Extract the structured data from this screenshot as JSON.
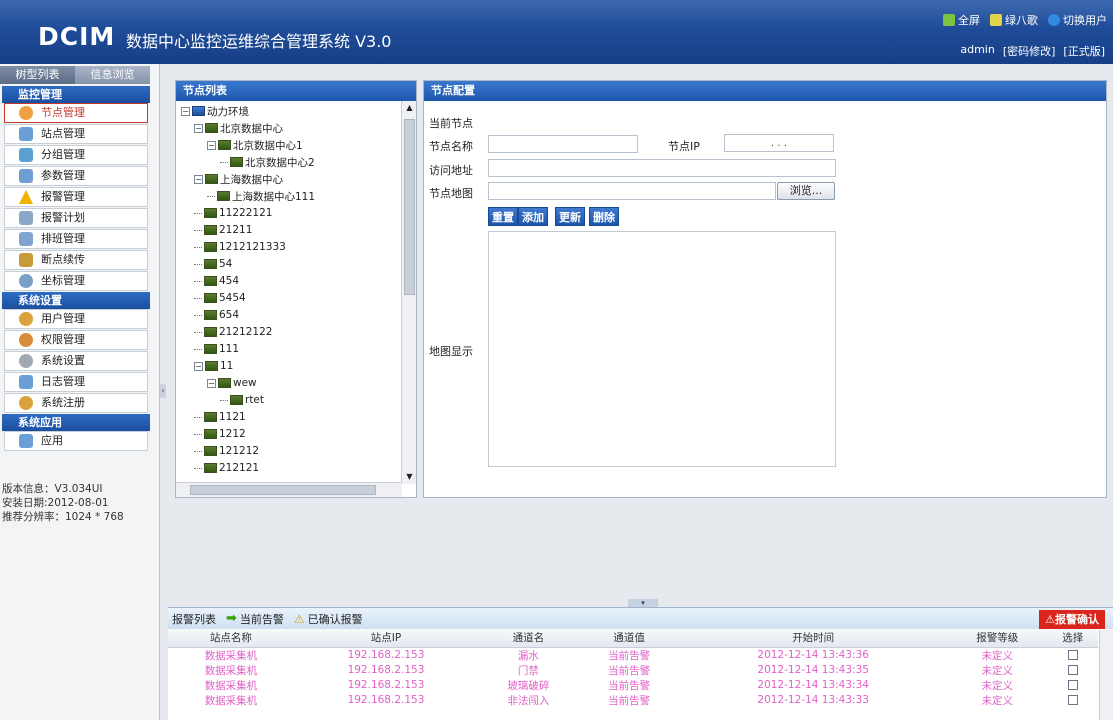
{
  "header": {
    "logo": "DCIM",
    "title": "数据中心监控运维综合管理系统 V3.0",
    "top_links": [
      {
        "label": "全屏",
        "icon": "fullscreen-icon",
        "color": "#7dc242"
      },
      {
        "label": "绿八歌",
        "icon": "leaf-icon",
        "color": "#e3d34a"
      },
      {
        "label": "切换用户",
        "icon": "user-icon",
        "color": "#2f8ae0"
      }
    ],
    "user": "admin",
    "change_password": "[密码修改]",
    "edition": "[正式版]"
  },
  "left": {
    "tabs": [
      "树型列表",
      "信息浏览"
    ],
    "sections": [
      {
        "title": "监控管理",
        "items": [
          {
            "label": "节点管理",
            "icon": "node-icon",
            "color": "#f0a040",
            "active": true
          },
          {
            "label": "站点管理",
            "icon": "site-icon",
            "color": "#6a9fd8"
          },
          {
            "label": "分组管理",
            "icon": "group-icon",
            "color": "#5aa0d0"
          },
          {
            "label": "参数管理",
            "icon": "param-icon",
            "color": "#6c9ed4"
          },
          {
            "label": "报警管理",
            "icon": "warning-icon",
            "color": "#f0b400"
          },
          {
            "label": "报警计划",
            "icon": "calendar-icon",
            "color": "#8aa6c8"
          },
          {
            "label": "排班管理",
            "icon": "schedule-icon",
            "color": "#7fa4d0"
          },
          {
            "label": "断点续传",
            "icon": "resume-icon",
            "color": "#c89a3a"
          },
          {
            "label": "坐标管理",
            "icon": "coordinate-icon",
            "color": "#7aa0c8"
          }
        ]
      },
      {
        "title": "系统设置",
        "items": [
          {
            "label": "用户管理",
            "icon": "users-icon",
            "color": "#d9a23a"
          },
          {
            "label": "权限管理",
            "icon": "permission-icon",
            "color": "#d98a3a"
          },
          {
            "label": "系统设置",
            "icon": "gear-icon",
            "color": "#a0a8b4"
          },
          {
            "label": "日志管理",
            "icon": "log-icon",
            "color": "#6a9fd8"
          },
          {
            "label": "系统注册",
            "icon": "register-icon",
            "color": "#d9a23a"
          }
        ]
      },
      {
        "title": "系统应用",
        "items": [
          {
            "label": "应用",
            "icon": "app-icon",
            "color": "#6a9fd8"
          }
        ]
      }
    ],
    "sysinfo": [
      "版本信息：V3.034UI",
      "安装日期:2012-08-01",
      "推荐分辨率：1024 * 768"
    ]
  },
  "tree_panel": {
    "title": "节点列表",
    "nodes": [
      "动力环境",
      "北京数据中心",
      "北京数据中心1",
      "北京数据中心2",
      "上海数据中心",
      "上海数据中心111",
      "11222121",
      "21211",
      "1212121333",
      "54",
      "454",
      "5454",
      "654",
      "21212122",
      "111",
      "11",
      "wew",
      "rtet",
      "1121",
      "1212",
      "121212",
      "212121"
    ]
  },
  "config_panel": {
    "title": "节点配置",
    "current_node_label": "当前节点",
    "name_label": "节点名称",
    "ip_label": "节点IP",
    "url_label": "访问地址",
    "map_label": "节点地图",
    "browse_label": "浏览...",
    "buttons": [
      "重置",
      "添加",
      "更新",
      "删除"
    ],
    "map_display_label": "地图显示",
    "ip_value": ". . ."
  },
  "alarm": {
    "list_label": "报警列表",
    "tab_current": "当前告警",
    "tab_confirmed": "已确认报警",
    "confirm_button": "报警确认",
    "columns": [
      "站点名称",
      "站点IP",
      "通道名",
      "通道值",
      "开始时间",
      "报警等级",
      "选择"
    ],
    "rows": [
      [
        "数据采集机",
        "192.168.2.153",
        "漏水",
        "当前告警",
        "2012-12-14 13:43:36",
        "未定义"
      ],
      [
        "数据采集机",
        "192.168.2.153",
        "门禁",
        "当前告警",
        "2012-12-14 13:43:35",
        "未定义"
      ],
      [
        "数据采集机",
        "192.168.2.153",
        "玻璃破碎",
        "当前告警",
        "2012-12-14 13:43:34",
        "未定义"
      ],
      [
        "数据采集机",
        "192.168.2.153",
        "非法闯入",
        "当前告警",
        "2012-12-14 13:43:33",
        "未定义"
      ]
    ]
  }
}
